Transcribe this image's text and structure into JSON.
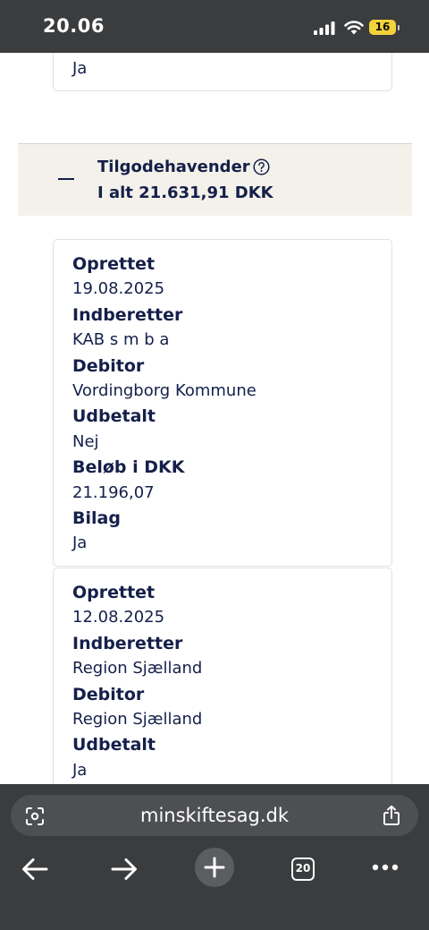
{
  "status_bar": {
    "time": "20.06",
    "battery": "16"
  },
  "previous_card": {
    "value": "Ja"
  },
  "section": {
    "title": "Tilgodehavender",
    "total": "I alt 21.631,91 DKK"
  },
  "cards": [
    {
      "fields": [
        {
          "label": "Oprettet",
          "value": "19.08.2025"
        },
        {
          "label": "Indberetter",
          "value": "KAB s m b a"
        },
        {
          "label": "Debitor",
          "value": "Vordingborg Kommune"
        },
        {
          "label": "Udbetalt",
          "value": "Nej"
        },
        {
          "label": "Beløb i DKK",
          "value": "21.196,07"
        },
        {
          "label": "Bilag",
          "value": "Ja"
        }
      ]
    },
    {
      "fields": [
        {
          "label": "Oprettet",
          "value": "12.08.2025"
        },
        {
          "label": "Indberetter",
          "value": "Region Sjælland"
        },
        {
          "label": "Debitor",
          "value": "Region Sjælland"
        },
        {
          "label": "Udbetalt",
          "value": "Ja"
        }
      ]
    }
  ],
  "browser": {
    "url": "minskiftesag.dk",
    "tab_count": "20"
  },
  "colors": {
    "text": "#14204a",
    "section_bg": "#f4f1ea",
    "chrome_bg": "#3a3c3e",
    "battery": "#f2d33a"
  },
  "icons": [
    "signal-icon",
    "wifi-icon",
    "battery-icon",
    "help-circle-icon",
    "minus-icon",
    "page-settings-icon",
    "share-icon",
    "back-arrow-icon",
    "forward-arrow-icon",
    "plus-icon",
    "tabs-icon",
    "more-icon"
  ]
}
